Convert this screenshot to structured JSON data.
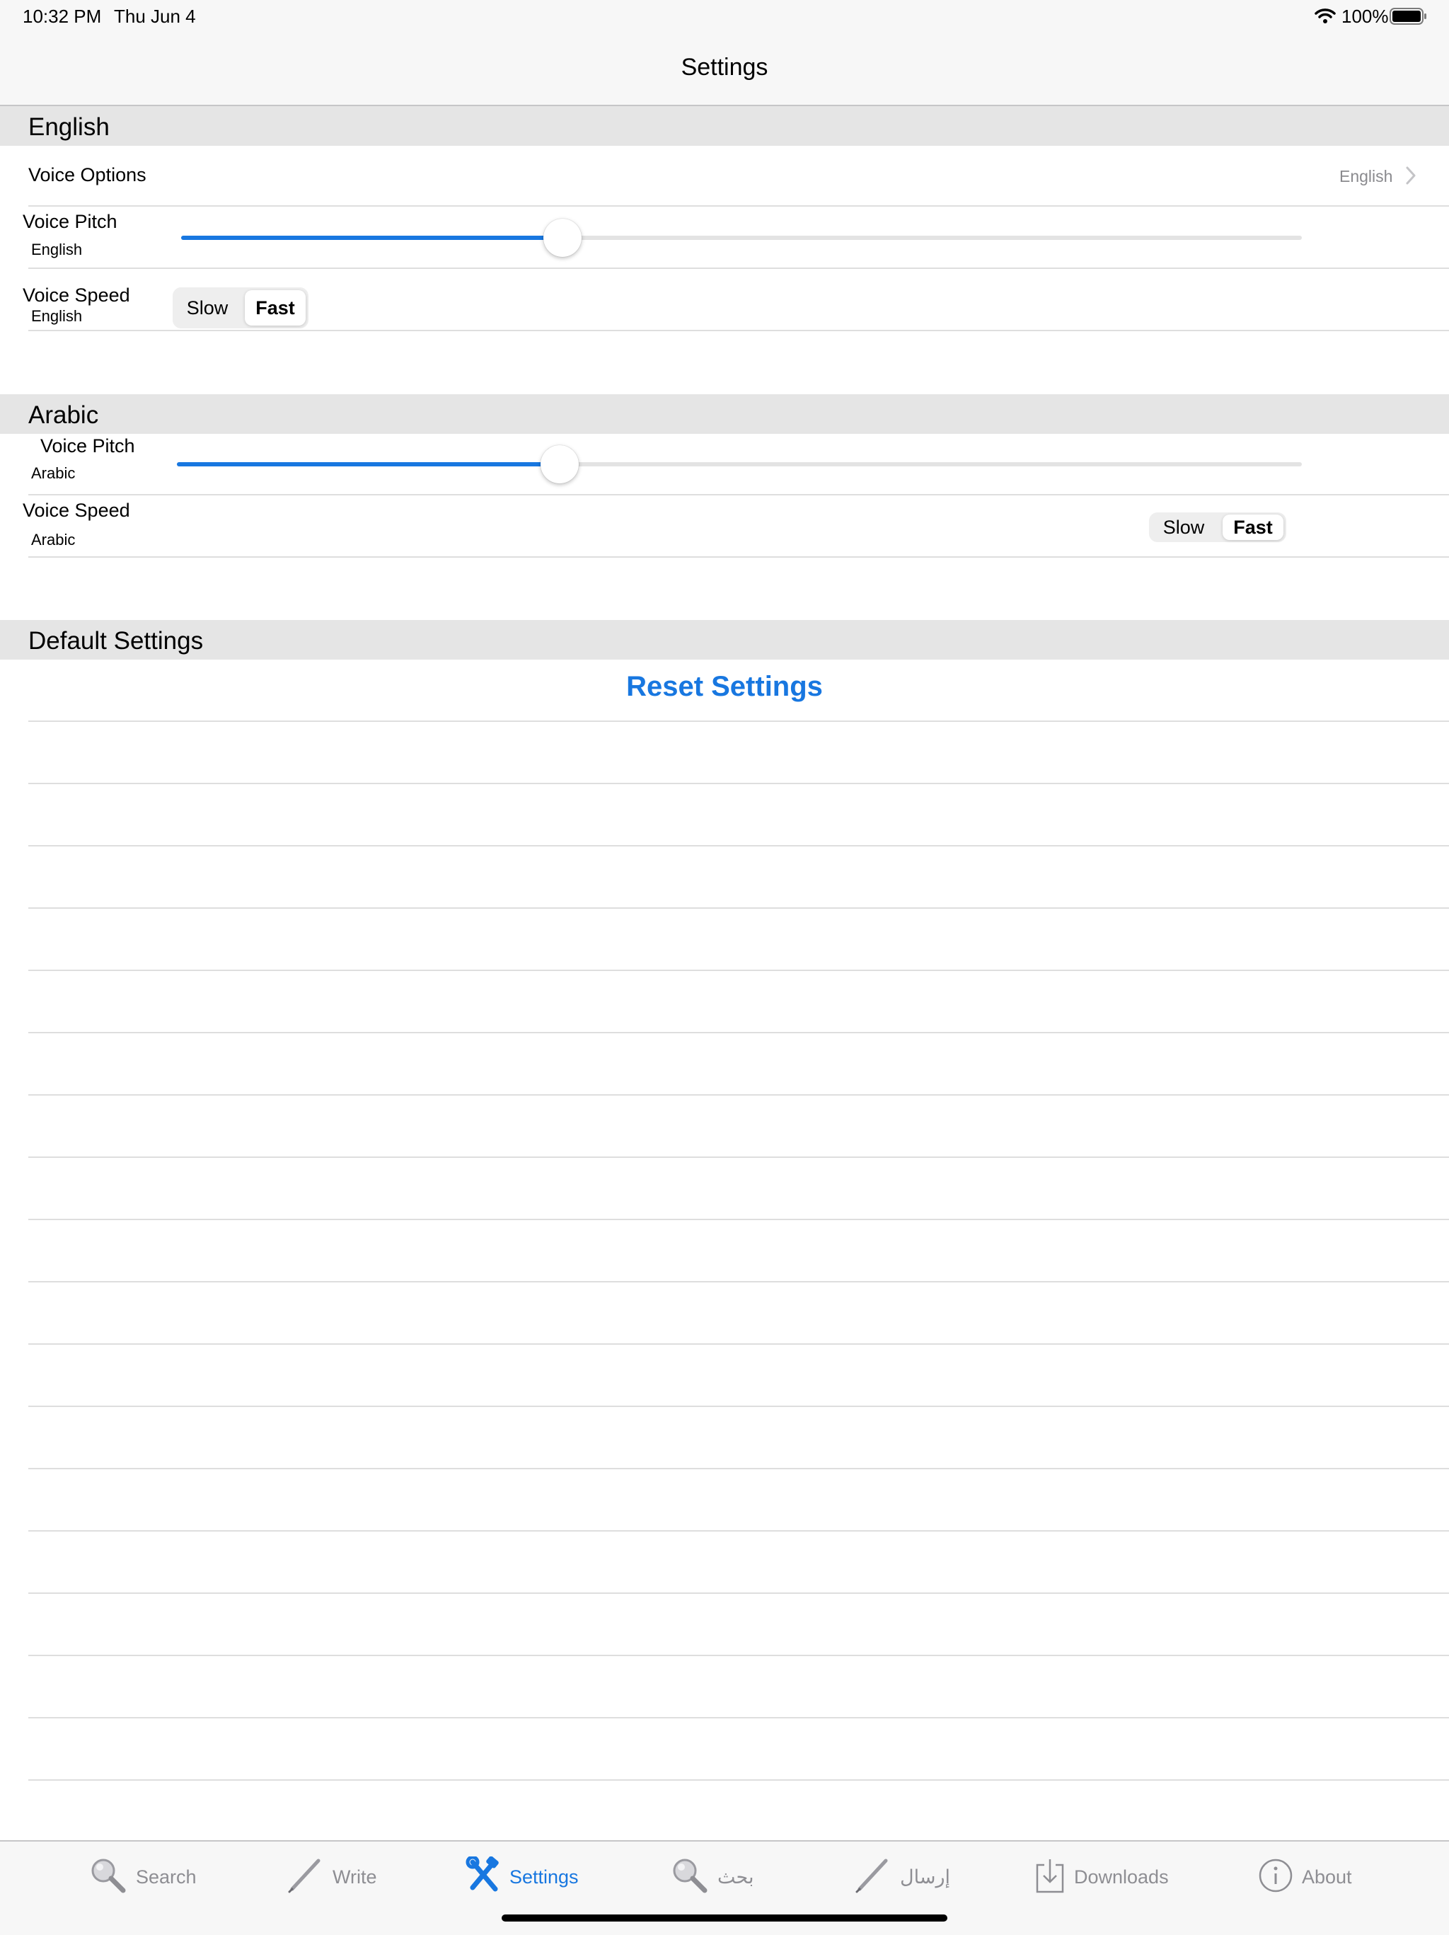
{
  "status": {
    "time": "10:32 PM",
    "date": "Thu Jun 4",
    "battery": "100%"
  },
  "nav": {
    "title": "Settings"
  },
  "english": {
    "header": "English",
    "voice_options": {
      "label": "Voice Options",
      "value": "English"
    },
    "pitch": {
      "label": "Voice Pitch",
      "sub": "English",
      "value_fraction": 0.34
    },
    "speed": {
      "label": "Voice Speed",
      "sub": "English",
      "options": [
        "Slow",
        "Fast"
      ],
      "selected": "Fast"
    }
  },
  "arabic": {
    "header": "Arabic",
    "pitch": {
      "label": "Voice Pitch",
      "sub": "Arabic",
      "value_fraction": 0.34
    },
    "speed": {
      "label": "Voice Speed",
      "sub": "Arabic",
      "options": [
        "Slow",
        "Fast"
      ],
      "selected": "Fast"
    }
  },
  "defaults": {
    "header": "Default Settings",
    "reset_label": "Reset Settings"
  },
  "tabs": [
    {
      "label": "Search",
      "icon": "magnifier-icon",
      "active": false
    },
    {
      "label": "Write",
      "icon": "pencil-icon",
      "active": false
    },
    {
      "label": "Settings",
      "icon": "tools-icon",
      "active": true
    },
    {
      "label": "بحث",
      "icon": "magnifier-icon",
      "active": false
    },
    {
      "label": "إرسال",
      "icon": "pencil-icon",
      "active": false
    },
    {
      "label": "Downloads",
      "icon": "download-icon",
      "active": false
    },
    {
      "label": "About",
      "icon": "info-icon",
      "active": false
    }
  ],
  "colors": {
    "accent": "#1877e0",
    "header_bg": "#e5e5e5",
    "bar_bg": "#f7f7f7"
  }
}
